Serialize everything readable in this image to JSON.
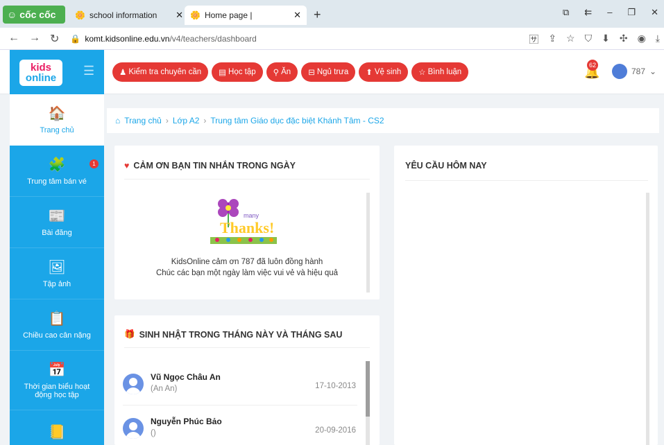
{
  "browser": {
    "brand": "cốc cốc",
    "tabs": [
      {
        "label": "school information"
      },
      {
        "label": "Home page |"
      }
    ],
    "url_domain": "komt.kidsonline.edu.vn",
    "url_path": "/v4/teachers/dashboard"
  },
  "app": {
    "logo_line1": "kids",
    "logo_line2": "online",
    "actions": [
      {
        "label": "Kiểm tra chuyên cần",
        "icon": "person-icon"
      },
      {
        "label": "Học tập",
        "icon": "book-icon"
      },
      {
        "label": "Ăn",
        "icon": "utensils-icon"
      },
      {
        "label": "Ngủ trưa",
        "icon": "bed-icon"
      },
      {
        "label": "Vệ sinh",
        "icon": "toilet-icon"
      },
      {
        "label": "Bình luận",
        "icon": "star-icon"
      }
    ],
    "notifications": "62",
    "user": "787"
  },
  "sidebar": {
    "items": [
      {
        "label": "Trang chủ",
        "icon": "home-icon"
      },
      {
        "label": "Trung tâm bán vé",
        "icon": "ticket-icon",
        "badge": "1"
      },
      {
        "label": "Bài đăng",
        "icon": "post-icon"
      },
      {
        "label": "Tập ảnh",
        "icon": "photo-icon"
      },
      {
        "label": "Chiều cao cân nặng",
        "icon": "scale-icon"
      },
      {
        "label": "Thời gian biểu hoạt động học tập",
        "icon": "calendar-icon"
      }
    ]
  },
  "breadcrumb": {
    "home": "Trang chủ",
    "class": "Lớp A2",
    "center": "Trung tâm Giáo dục đặc biệt Khánh Tâm - CS2"
  },
  "thanks": {
    "title": "CẢM ƠN BẠN TIN NHẮN TRONG NGÀY",
    "line1": "KidsOnline cảm ơn 787 đã luôn đồng hành",
    "line2": "Chúc các bạn một ngày làm việc vui vẻ và hiệu quả"
  },
  "requests": {
    "title": "YÊU CẦU HÔM NAY"
  },
  "birthdays": {
    "title": "SINH NHẬT TRONG THÁNG NÀY VÀ THÁNG SAU",
    "rows": [
      {
        "name": "Vũ Ngọc Châu An",
        "nick": "(An An)",
        "date": "17-10-2013"
      },
      {
        "name": "Nguyễn Phúc Bảo",
        "nick": "()",
        "date": "20-09-2016"
      }
    ]
  }
}
